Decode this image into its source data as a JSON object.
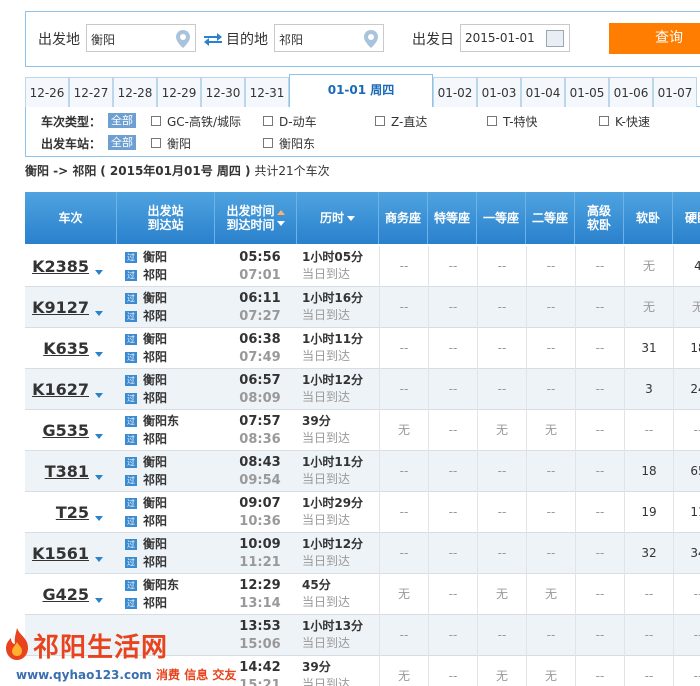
{
  "search": {
    "from_label": "出发地",
    "from_value": "衡阳",
    "to_label": "目的地",
    "to_value": "祁阳",
    "date_label": "出发日",
    "date_value": "2015-01-01",
    "query_button": "查询"
  },
  "date_tabs": [
    "12-26",
    "12-27",
    "12-28",
    "12-29",
    "12-30",
    "12-31",
    "01-01 周四",
    "01-02",
    "01-03",
    "01-04",
    "01-05",
    "01-06",
    "01-07"
  ],
  "filters": {
    "type_label": "车次类型：",
    "all_label": "全部",
    "types": [
      "GC-高铁/城际",
      "D-动车",
      "Z-直达",
      "T-特快",
      "K-快速"
    ],
    "station_label": "出发车站：",
    "stations": [
      "衡阳",
      "衡阳东"
    ]
  },
  "summary": {
    "route": "衡阳 -> 祁阳",
    "date_text": "( 2015年01月01号  周四 )",
    "count_text": "共计21个车次"
  },
  "table": {
    "headers": {
      "train": "车次",
      "station_top": "出发站",
      "station_bottom": "到达站",
      "time_top": "出发时间",
      "time_bottom": "到达时间",
      "duration": "历时",
      "business": "商务座",
      "special": "特等座",
      "first": "一等座",
      "second": "二等座",
      "adv_soft_top": "高级",
      "adv_soft_bottom": "软卧",
      "soft_sleeper": "软卧",
      "hard_sleeper": "硬卧"
    },
    "pass_icon": "过",
    "rows": [
      {
        "train": "K2385",
        "from": "衡阳",
        "to": "祁阳",
        "dep": "05:56",
        "arr": "07:01",
        "dur": "1小时05分",
        "day": "当日到达",
        "seats": [
          "--",
          "--",
          "--",
          "--",
          "--",
          "无",
          "4"
        ]
      },
      {
        "train": "K9127",
        "from": "衡阳",
        "to": "祁阳",
        "dep": "06:11",
        "arr": "07:27",
        "dur": "1小时16分",
        "day": "当日到达",
        "seats": [
          "--",
          "--",
          "--",
          "--",
          "--",
          "无",
          "无"
        ]
      },
      {
        "train": "K635",
        "from": "衡阳",
        "to": "祁阳",
        "dep": "06:38",
        "arr": "07:49",
        "dur": "1小时11分",
        "day": "当日到达",
        "seats": [
          "--",
          "--",
          "--",
          "--",
          "--",
          "31",
          "18"
        ]
      },
      {
        "train": "K1627",
        "from": "衡阳",
        "to": "祁阳",
        "dep": "06:57",
        "arr": "08:09",
        "dur": "1小时12分",
        "day": "当日到达",
        "seats": [
          "--",
          "--",
          "--",
          "--",
          "--",
          "3",
          "24"
        ]
      },
      {
        "train": "G535",
        "from": "衡阳东",
        "to": "祁阳",
        "dep": "07:57",
        "arr": "08:36",
        "dur": "39分",
        "day": "当日到达",
        "seats": [
          "无",
          "--",
          "无",
          "无",
          "--",
          "--",
          "--"
        ]
      },
      {
        "train": "T381",
        "from": "衡阳",
        "to": "祁阳",
        "dep": "08:43",
        "arr": "09:54",
        "dur": "1小时11分",
        "day": "当日到达",
        "seats": [
          "--",
          "--",
          "--",
          "--",
          "--",
          "18",
          "65"
        ]
      },
      {
        "train": "T25",
        "from": "衡阳",
        "to": "祁阳",
        "dep": "09:07",
        "arr": "10:36",
        "dur": "1小时29分",
        "day": "当日到达",
        "seats": [
          "--",
          "--",
          "--",
          "--",
          "--",
          "19",
          "11"
        ]
      },
      {
        "train": "K1561",
        "from": "衡阳",
        "to": "祁阳",
        "dep": "10:09",
        "arr": "11:21",
        "dur": "1小时12分",
        "day": "当日到达",
        "seats": [
          "--",
          "--",
          "--",
          "--",
          "--",
          "32",
          "34"
        ]
      },
      {
        "train": "G425",
        "from": "衡阳东",
        "to": "祁阳",
        "dep": "12:29",
        "arr": "13:14",
        "dur": "45分",
        "day": "当日到达",
        "seats": [
          "无",
          "--",
          "无",
          "无",
          "--",
          "--",
          "--"
        ]
      },
      {
        "train": "",
        "from": "",
        "to": "",
        "dep": "13:53",
        "arr": "15:06",
        "dur": "1小时13分",
        "day": "当日到达",
        "seats": [
          "--",
          "--",
          "--",
          "--",
          "--",
          "--",
          "--"
        ]
      },
      {
        "train": "",
        "from": "",
        "to": "",
        "dep": "14:42",
        "arr": "15:21",
        "dur": "39分",
        "day": "当日到达",
        "seats": [
          "无",
          "--",
          "无",
          "无",
          "--",
          "--",
          "--"
        ]
      }
    ]
  },
  "watermark": {
    "brand": "祁阳生活网",
    "url": "www.qyhao123.com",
    "tags": "消费 信息 交友"
  },
  "colors": {
    "accent": "#2a81cc",
    "query_button": "#ff7d00",
    "brand": "#e8431d"
  }
}
